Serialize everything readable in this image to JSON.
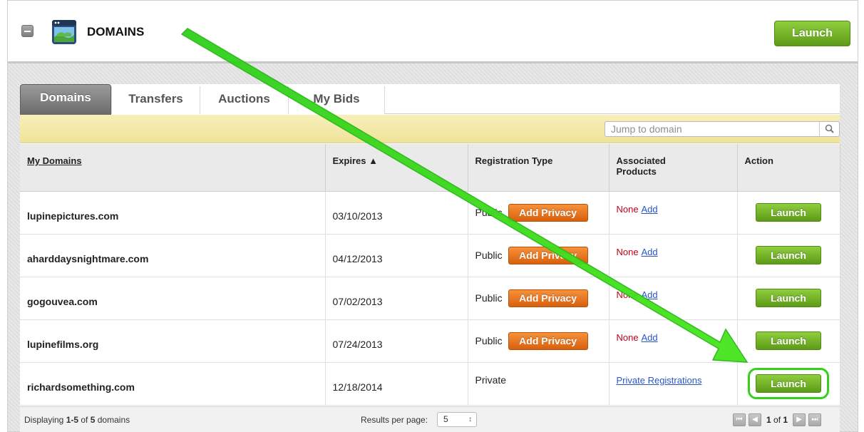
{
  "header": {
    "title": "DOMAINS",
    "launch_label": "Launch"
  },
  "tabs": [
    {
      "label": "Domains",
      "active": true
    },
    {
      "label": "Transfers",
      "active": false
    },
    {
      "label": "Auctions",
      "active": false
    },
    {
      "label": "My Bids",
      "active": false
    }
  ],
  "search": {
    "placeholder": "Jump to domain"
  },
  "table": {
    "columns": {
      "domain": "My Domains",
      "expires": "Expires ▲",
      "regtype": "Registration Type",
      "assoc": "Associated Products",
      "action": "Action"
    },
    "rows": [
      {
        "domain": "lupinepictures.com",
        "expires": "03/10/2013",
        "regtype": "Public",
        "privacy_btn": "Add Privacy",
        "assoc_none": "None",
        "assoc_link": "Add",
        "launch": "Launch"
      },
      {
        "domain": "aharddaysnightmare.com",
        "expires": "04/12/2013",
        "regtype": "Public",
        "privacy_btn": "Add Privacy",
        "assoc_none": "None",
        "assoc_link": "Add",
        "launch": "Launch"
      },
      {
        "domain": "gogouvea.com",
        "expires": "07/02/2013",
        "regtype": "Public",
        "privacy_btn": "Add Privacy",
        "assoc_none": "None",
        "assoc_link": "Add",
        "launch": "Launch"
      },
      {
        "domain": "lupinefilms.org",
        "expires": "07/24/2013",
        "regtype": "Public",
        "privacy_btn": "Add Privacy",
        "assoc_none": "None",
        "assoc_link": "Add",
        "launch": "Launch"
      },
      {
        "domain": "richardsomething.com",
        "expires": "12/18/2014",
        "regtype": "Private",
        "assoc_link": "Private Registrations",
        "launch": "Launch"
      }
    ]
  },
  "footer": {
    "displaying_prefix": "Displaying ",
    "displaying_range": "1-5",
    "displaying_of": " of ",
    "displaying_total": "5",
    "displaying_suffix": " domains",
    "results_per_page_label": "Results per page:",
    "results_per_page_value": "5",
    "page_current": "1",
    "page_of": " of ",
    "page_total": "1"
  },
  "colors": {
    "launch_green": "#6fb024",
    "privacy_orange": "#e8741f",
    "toolbar_yellow": "#f3e9a8",
    "annotation_arrow": "#3ddc1a"
  }
}
